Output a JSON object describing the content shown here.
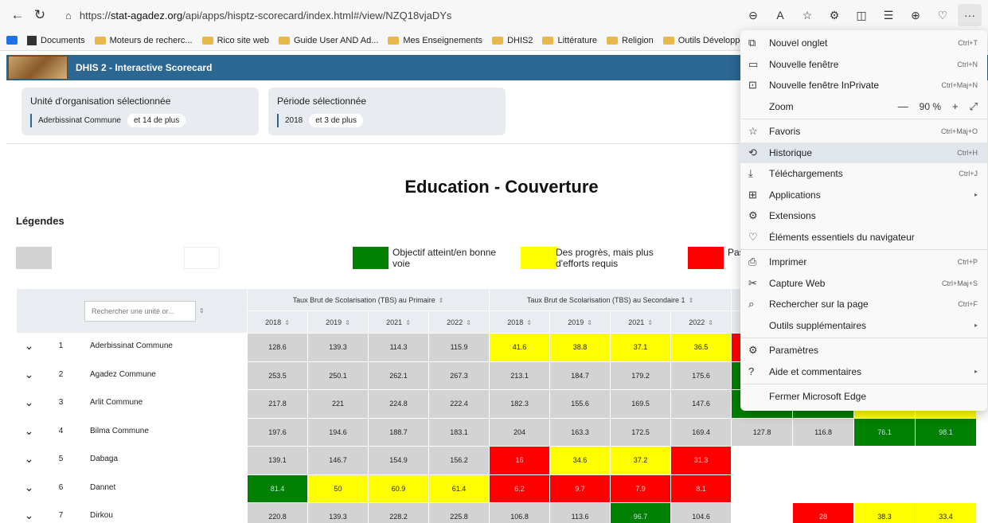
{
  "browser": {
    "url_prefix": "https://",
    "url_domain": "stat-agadez.org",
    "url_rest": "/api/apps/hisptz-scorecard/index.html#/view/NZQ18vjaDYs",
    "bookmarks": [
      "Documents",
      "Moteurs de recherc...",
      "Rico site web",
      "Guide User AND Ad...",
      "Mes Enseignements",
      "DHIS2",
      "Littérature",
      "Religion",
      "Outils Développem..."
    ]
  },
  "app": {
    "title": "DHIS 2 - Interactive Scorecard"
  },
  "filters": {
    "org_unit": {
      "title": "Unité d'organisation sélectionnée",
      "value": "Aderbissinat Commune",
      "more": "et 14 de plus"
    },
    "period": {
      "title": "Période sélectionnée",
      "value": "2018",
      "more": "et 3 de plus"
    }
  },
  "scorecard": {
    "title": "Education - Couverture",
    "legends_label": "Légendes",
    "legend": [
      {
        "color": "#d3d3d3",
        "label": ""
      },
      {
        "color": "#ffffff",
        "label": ""
      },
      {
        "color": "#008000",
        "label": "Objectif atteint/en bonne voie"
      },
      {
        "color": "#ffff00",
        "label": "Des progrès, mais plus d'efforts requis"
      },
      {
        "color": "#ff0000",
        "label": "Pas"
      }
    ],
    "search_placeholder": "Rechercher une unité or...",
    "groups": [
      "Taux Brut de Scolarisation (TBS) au Primaire",
      "Taux Brut de Scolarisation (TBS) au Secondaire 1"
    ],
    "periods": [
      "2018",
      "2019",
      "2021",
      "2022",
      "2018",
      "2019",
      "2021",
      "2022"
    ],
    "rows": [
      {
        "num": "1",
        "name": "Aderbissinat Commune",
        "cells": [
          [
            "128.6",
            "grey"
          ],
          [
            "139.3",
            "grey"
          ],
          [
            "114.3",
            "grey"
          ],
          [
            "115.9",
            "grey"
          ],
          [
            "41.6",
            "yellow"
          ],
          [
            "38.8",
            "yellow"
          ],
          [
            "37.1",
            "yellow"
          ],
          [
            "36.5",
            "yellow"
          ],
          [
            "",
            "red"
          ],
          [
            "",
            "white"
          ],
          [
            "",
            "white"
          ],
          [
            "",
            "white"
          ]
        ]
      },
      {
        "num": "2",
        "name": "Agadez Commune",
        "cells": [
          [
            "253.5",
            "grey"
          ],
          [
            "250.1",
            "grey"
          ],
          [
            "262.1",
            "grey"
          ],
          [
            "267.3",
            "grey"
          ],
          [
            "213.1",
            "grey"
          ],
          [
            "184.7",
            "grey"
          ],
          [
            "179.2",
            "grey"
          ],
          [
            "175.6",
            "grey"
          ],
          [
            "",
            "green"
          ],
          [
            "",
            "white"
          ],
          [
            "",
            "white"
          ],
          [
            "",
            "white"
          ]
        ]
      },
      {
        "num": "3",
        "name": "Arlit Commune",
        "cells": [
          [
            "217.8",
            "grey"
          ],
          [
            "221",
            "grey"
          ],
          [
            "224.8",
            "grey"
          ],
          [
            "222.4",
            "grey"
          ],
          [
            "182.3",
            "grey"
          ],
          [
            "155.6",
            "grey"
          ],
          [
            "169.5",
            "grey"
          ],
          [
            "147.6",
            "grey"
          ],
          [
            "",
            "green"
          ],
          [
            "",
            "green"
          ],
          [
            "",
            "yellow"
          ],
          [
            "",
            "yellow"
          ]
        ]
      },
      {
        "num": "4",
        "name": "Bilma Commune",
        "cells": [
          [
            "197.6",
            "grey"
          ],
          [
            "194.6",
            "grey"
          ],
          [
            "188.7",
            "grey"
          ],
          [
            "183.1",
            "grey"
          ],
          [
            "204",
            "grey"
          ],
          [
            "163.3",
            "grey"
          ],
          [
            "172.5",
            "grey"
          ],
          [
            "169.4",
            "grey"
          ],
          [
            "127.8",
            "grey"
          ],
          [
            "116.8",
            "grey"
          ],
          [
            "76.1",
            "green"
          ],
          [
            "98.1",
            "green"
          ]
        ]
      },
      {
        "num": "5",
        "name": "Dabaga",
        "cells": [
          [
            "139.1",
            "grey"
          ],
          [
            "146.7",
            "grey"
          ],
          [
            "154.9",
            "grey"
          ],
          [
            "156.2",
            "grey"
          ],
          [
            "16",
            "red"
          ],
          [
            "34.6",
            "yellow"
          ],
          [
            "37.2",
            "yellow"
          ],
          [
            "31.3",
            "red"
          ],
          [
            "",
            "white"
          ],
          [
            "",
            "white"
          ],
          [
            "",
            "white"
          ],
          [
            "",
            "white"
          ]
        ]
      },
      {
        "num": "6",
        "name": "Dannet",
        "cells": [
          [
            "81.4",
            "green"
          ],
          [
            "50",
            "yellow"
          ],
          [
            "60.9",
            "yellow"
          ],
          [
            "61.4",
            "yellow"
          ],
          [
            "6.2",
            "red"
          ],
          [
            "9.7",
            "red"
          ],
          [
            "7.9",
            "red"
          ],
          [
            "8.1",
            "red"
          ],
          [
            "",
            "white"
          ],
          [
            "",
            "white"
          ],
          [
            "",
            "white"
          ],
          [
            "",
            "white"
          ]
        ]
      },
      {
        "num": "7",
        "name": "Dirkou",
        "cells": [
          [
            "220.8",
            "grey"
          ],
          [
            "139.3",
            "grey"
          ],
          [
            "228.2",
            "grey"
          ],
          [
            "225.8",
            "grey"
          ],
          [
            "106.8",
            "grey"
          ],
          [
            "113.6",
            "grey"
          ],
          [
            "96.7",
            "green"
          ],
          [
            "104.6",
            "grey"
          ],
          [
            "",
            "white"
          ],
          [
            "28",
            "red"
          ],
          [
            "38.3",
            "yellow"
          ],
          [
            "33.4",
            "yellow"
          ]
        ]
      }
    ]
  },
  "menu": {
    "items": [
      {
        "icon": "⧉",
        "icon_name": "new-tab-icon",
        "label": "Nouvel onglet",
        "shortcut": "Ctrl+T"
      },
      {
        "icon": "▭",
        "icon_name": "new-window-icon",
        "label": "Nouvelle fenêtre",
        "shortcut": "Ctrl+N"
      },
      {
        "icon": "⊡",
        "icon_name": "inprivate-icon",
        "label": "Nouvelle fenêtre InPrivate",
        "shortcut": "Ctrl+Maj+N"
      },
      {
        "type": "zoom",
        "label": "Zoom",
        "value": "90 %"
      },
      {
        "type": "sep"
      },
      {
        "icon": "☆",
        "icon_name": "favorites-icon",
        "label": "Favoris",
        "shortcut": "Ctrl+Maj+O"
      },
      {
        "icon": "⟲",
        "icon_name": "history-icon",
        "label": "Historique",
        "shortcut": "Ctrl+H",
        "highlight": true
      },
      {
        "icon": "⤓",
        "icon_name": "download-icon",
        "label": "Téléchargements",
        "shortcut": "Ctrl+J"
      },
      {
        "icon": "⊞",
        "icon_name": "apps-icon",
        "label": "Applications",
        "arrow": true
      },
      {
        "icon": "⚙",
        "icon_name": "extensions-icon",
        "label": "Extensions"
      },
      {
        "icon": "♡",
        "icon_name": "browser-essentials-icon",
        "label": "Éléments essentiels du navigateur"
      },
      {
        "type": "sep"
      },
      {
        "icon": "⎙",
        "icon_name": "print-icon",
        "label": "Imprimer",
        "shortcut": "Ctrl+P"
      },
      {
        "icon": "✂",
        "icon_name": "web-capture-icon",
        "label": "Capture Web",
        "shortcut": "Ctrl+Maj+S"
      },
      {
        "icon": "⌕",
        "icon_name": "find-icon",
        "label": "Rechercher sur la page",
        "shortcut": "Ctrl+F"
      },
      {
        "icon": "",
        "icon_name": "",
        "label": "Outils supplémentaires",
        "arrow": true
      },
      {
        "type": "sep"
      },
      {
        "icon": "⚙",
        "icon_name": "settings-icon",
        "label": "Paramètres"
      },
      {
        "icon": "?",
        "icon_name": "help-icon",
        "label": "Aide et commentaires",
        "arrow": true
      },
      {
        "type": "sep"
      },
      {
        "icon": "",
        "icon_name": "",
        "label": "Fermer Microsoft Edge"
      }
    ]
  }
}
